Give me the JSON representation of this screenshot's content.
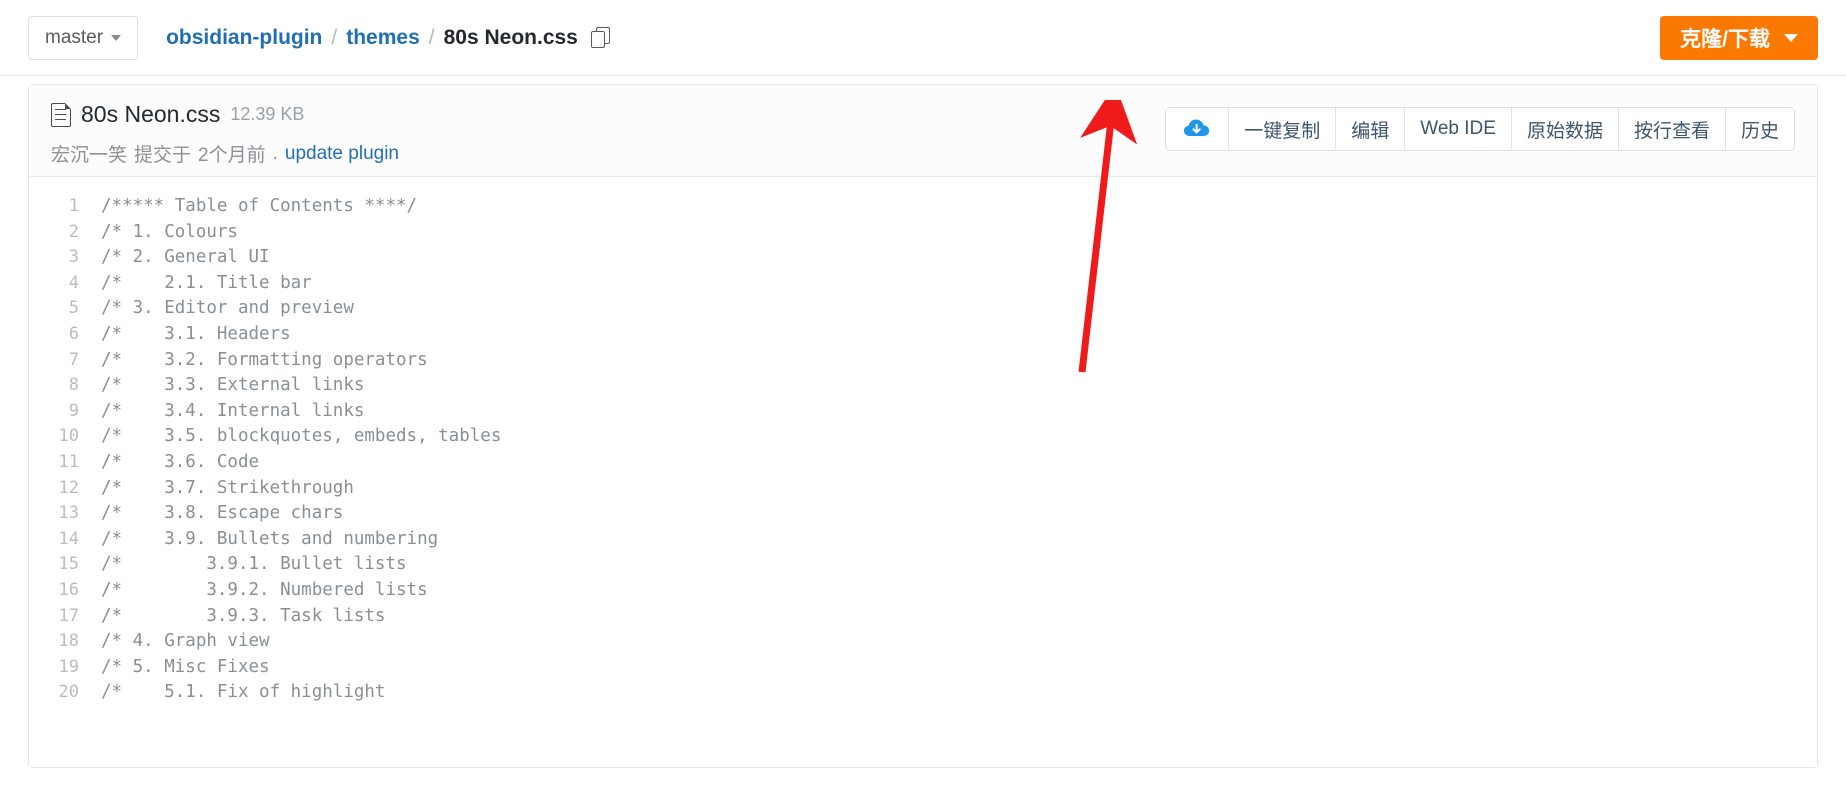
{
  "topbar": {
    "branch": {
      "label": "master",
      "icon": "chevron-down-icon"
    },
    "breadcrumb": {
      "repo": "obsidian-plugin",
      "folder": "themes",
      "file": "80s Neon.css",
      "separator": "/",
      "copy_icon": "copy-icon"
    },
    "clone_button": {
      "label": "克隆/下载",
      "icon": "chevron-down-icon",
      "color": "#fb7900"
    }
  },
  "file": {
    "icon": "file-text-icon",
    "name": "80s Neon.css",
    "size": "12.39 KB",
    "commit": {
      "author": "宏沉一笑",
      "verb": "提交于",
      "time": "2个月前",
      "dot": ".",
      "message": "update plugin"
    },
    "actions": [
      {
        "name": "download-button",
        "label": "",
        "icon": "download-cloud-icon"
      },
      {
        "name": "copy-button",
        "label": "一键复制",
        "icon": ""
      },
      {
        "name": "edit-button",
        "label": "编辑",
        "icon": ""
      },
      {
        "name": "web-ide-button",
        "label": "Web IDE",
        "icon": ""
      },
      {
        "name": "raw-button",
        "label": "原始数据",
        "icon": ""
      },
      {
        "name": "blame-button",
        "label": "按行查看",
        "icon": ""
      },
      {
        "name": "history-button",
        "label": "历史",
        "icon": ""
      }
    ]
  },
  "code": {
    "lines": [
      {
        "n": "1",
        "text": "/***** Table of Contents ****/"
      },
      {
        "n": "2",
        "text": "/* 1. Colours"
      },
      {
        "n": "3",
        "text": "/* 2. General UI"
      },
      {
        "n": "4",
        "text": "/*    2.1. Title bar"
      },
      {
        "n": "5",
        "text": "/* 3. Editor and preview"
      },
      {
        "n": "6",
        "text": "/*    3.1. Headers"
      },
      {
        "n": "7",
        "text": "/*    3.2. Formatting operators"
      },
      {
        "n": "8",
        "text": "/*    3.3. External links"
      },
      {
        "n": "9",
        "text": "/*    3.4. Internal links"
      },
      {
        "n": "10",
        "text": "/*    3.5. blockquotes, embeds, tables"
      },
      {
        "n": "11",
        "text": "/*    3.6. Code"
      },
      {
        "n": "12",
        "text": "/*    3.7. Strikethrough"
      },
      {
        "n": "13",
        "text": "/*    3.8. Escape chars"
      },
      {
        "n": "14",
        "text": "/*    3.9. Bullets and numbering"
      },
      {
        "n": "15",
        "text": "/*        3.9.1. Bullet lists"
      },
      {
        "n": "16",
        "text": "/*        3.9.2. Numbered lists"
      },
      {
        "n": "17",
        "text": "/*        3.9.3. Task lists"
      },
      {
        "n": "18",
        "text": "/* 4. Graph view"
      },
      {
        "n": "19",
        "text": "/* 5. Misc Fixes"
      },
      {
        "n": "20",
        "text": "/*    5.1. Fix of highlight"
      }
    ]
  },
  "annotation": {
    "name": "red-arrow-pointer",
    "color": "#ef1b1b"
  }
}
